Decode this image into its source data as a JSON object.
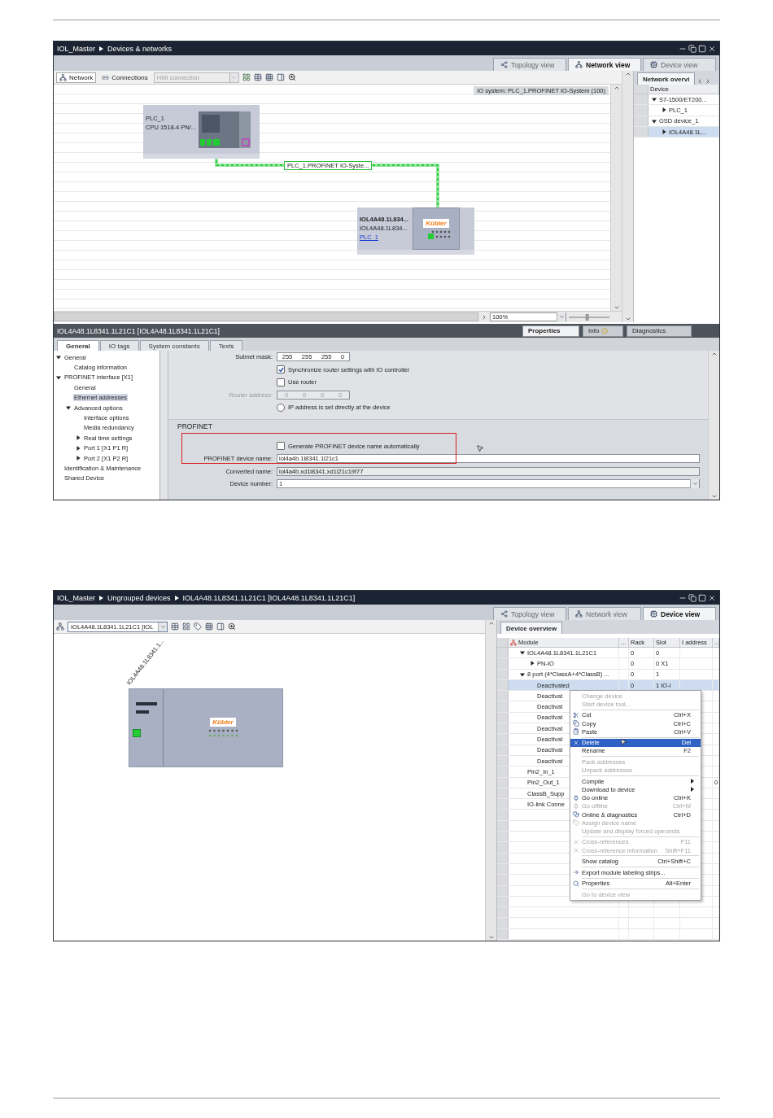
{
  "network_view": {
    "breadcrumb": [
      "IOL_Master",
      "Devices & networks"
    ],
    "view_tabs": [
      {
        "label": "Topology view",
        "selected": false
      },
      {
        "label": "Network view",
        "selected": true
      },
      {
        "label": "Device view",
        "selected": false
      }
    ],
    "toolbar": {
      "network": "Network",
      "connections": "Connections",
      "connection_type": {
        "value": "HMI connection",
        "disabled": true
      }
    },
    "io_system": "IO system: PLC_1.PROFINET IO-System (100)",
    "plc": {
      "name": "PLC_1",
      "type": "CPU 1518-4 PN/..."
    },
    "subnet": "PLC_1.PROFINET IO-Syste...",
    "device": {
      "name": "IOL4A48.1L834...",
      "type": "IOL4A48.1L834...",
      "link": "PLC_1",
      "logo": "Kübler"
    },
    "zoom": "100%",
    "zoom_slider": {
      "level": 0.45
    },
    "overview": {
      "tab": "Network overvi",
      "column": "Device",
      "tree": [
        {
          "label": "S7-1500/ET200...",
          "expanded": true,
          "selected": false,
          "children": [
            {
              "label": "PLC_1",
              "expanded": false,
              "selected": false
            }
          ]
        },
        {
          "label": "GSD device_1",
          "expanded": true,
          "selected": false,
          "children": [
            {
              "label": "IOL4A48.1L...",
              "expanded": false,
              "selected": true
            }
          ]
        }
      ]
    },
    "inspector": {
      "title": "IOL4A48.1L8341.1L21C1 [IOL4A48.1L8341.1L21C1]",
      "panel_tabs": [
        {
          "label": "Properties",
          "selected": true
        },
        {
          "label": "Info",
          "selected": false
        },
        {
          "label": "Diagnostics",
          "selected": false
        }
      ],
      "tabs": [
        {
          "label": "General",
          "selected": true
        },
        {
          "label": "IO tags",
          "selected": false
        },
        {
          "label": "System constants",
          "selected": false
        },
        {
          "label": "Texts",
          "selected": false
        }
      ],
      "nav": [
        {
          "label": "General",
          "expanded": true,
          "selected": false,
          "children": [
            {
              "label": "Catalog information",
              "selected": false
            }
          ]
        },
        {
          "label": "PROFINET interface [X1]",
          "expanded": true,
          "selected": false,
          "children": [
            {
              "label": "General",
              "selected": false
            },
            {
              "label": "Ethernet addresses",
              "selected": true
            },
            {
              "label": "Advanced options",
              "expanded": true,
              "selected": false,
              "children": [
                {
                  "label": "Interface options",
                  "selected": false
                },
                {
                  "label": "Media redundancy",
                  "selected": false
                },
                {
                  "label": "Real time settings",
                  "expanded": false,
                  "selected": false
                },
                {
                  "label": "Port 1 [X1 P1 R]",
                  "expanded": false,
                  "selected": false
                },
                {
                  "label": "Port 2 [X1 P2 R]",
                  "expanded": false,
                  "selected": false
                }
              ]
            }
          ]
        },
        {
          "label": "Identification & Maintenance",
          "selected": false
        },
        {
          "label": "Shared Device",
          "selected": false
        }
      ],
      "subnet_mask": {
        "label": "Subnet mask:",
        "octets": [
          "255",
          "255",
          "255",
          "0"
        ]
      },
      "sync_router": {
        "label": "Synchronize router settings with IO controller",
        "checked": true
      },
      "use_router": {
        "label": "Use router",
        "checked": false
      },
      "router_address": {
        "label": "Router address:",
        "octets": [
          "0",
          "0",
          "0",
          "0"
        ],
        "disabled": true
      },
      "ip_direct": {
        "label": "IP address is set directly at the device",
        "selected": false
      },
      "profinet": {
        "title": "PROFINET",
        "auto_name": {
          "label": "Generate PROFINET device name automatically",
          "checked": false
        },
        "device_name": {
          "label": "PROFINET device name:",
          "value": "iol4a4b.1l8341.1l21c1"
        },
        "converted_name": {
          "label": "Converted name:",
          "value": "iol4a4b.xd1l8341.xd1l21c19f77"
        },
        "device_number": {
          "label": "Device number:",
          "value": "1"
        }
      }
    }
  },
  "device_view": {
    "breadcrumb": [
      "IOL_Master",
      "Ungrouped devices",
      "IOL4A48.1L8341.1L21C1 [IOL4A48.1L8341.1L21C1]"
    ],
    "view_tabs": [
      {
        "label": "Topology view",
        "selected": false
      },
      {
        "label": "Network view",
        "selected": false
      },
      {
        "label": "Device view",
        "selected": true
      }
    ],
    "device_select": "IOL4A48.1L8341.1L21C1 [IOL",
    "canvas_label": "IOL4A48.1L8341.1...",
    "logo": "Kübler",
    "overview": {
      "tab": "Device overview",
      "columns": [
        "Module",
        "...",
        "Rack",
        "Slot",
        "I address",
        "..."
      ],
      "rows": [
        {
          "module": "IOL4A48.1L8341.1L21C1",
          "rack": "0",
          "slot": "0",
          "expanded": true,
          "selected": false,
          "children": [
            {
              "module": "PN-IO",
              "rack": "0",
              "slot": "0 X1",
              "expanded": false,
              "selected": false
            }
          ]
        },
        {
          "module": "8 port (4*ClassA+4*ClassB) ...",
          "rack": "0",
          "slot": "1",
          "expanded": true,
          "selected": false,
          "children": [
            {
              "module": "Deactivated",
              "rack": "0",
              "slot": "1 IO-l",
              "selected": true
            },
            {
              "module": "Deactivat",
              "selected": false
            },
            {
              "module": "Deactivat",
              "selected": false
            },
            {
              "module": "Deactivat",
              "selected": false
            },
            {
              "module": "Deactivat",
              "selected": false
            },
            {
              "module": "Deactivat",
              "selected": false
            },
            {
              "module": "Deactivat",
              "selected": false
            },
            {
              "module": "Deactivat",
              "selected": false
            }
          ]
        },
        {
          "module": "Pin2_In_1",
          "selected": false
        },
        {
          "module": "Pin2_Out_1",
          "column_6": "0",
          "selected": false
        },
        {
          "module": "ClassB_Supp",
          "selected": false
        },
        {
          "module": "IO-link Conne",
          "selected": false
        }
      ]
    },
    "context_menu": [
      {
        "kind": "item",
        "label": "Change device",
        "disabled": true,
        "selected": false
      },
      {
        "kind": "item",
        "label": "Start device tool...",
        "disabled": true,
        "selected": false
      },
      {
        "kind": "separator"
      },
      {
        "kind": "item",
        "label": "Cut",
        "shortcut": "Ctrl+X",
        "disabled": false,
        "selected": false
      },
      {
        "kind": "item",
        "label": "Copy",
        "shortcut": "Ctrl+C",
        "disabled": false,
        "selected": false
      },
      {
        "kind": "item",
        "label": "Paste",
        "shortcut": "Ctrl+V",
        "disabled": false,
        "selected": false
      },
      {
        "kind": "separator"
      },
      {
        "kind": "item",
        "label": "Delete",
        "shortcut": "Del",
        "disabled": false,
        "selected": true
      },
      {
        "kind": "item",
        "label": "Rename",
        "shortcut": "F2",
        "disabled": false,
        "selected": false
      },
      {
        "kind": "separator"
      },
      {
        "kind": "item",
        "label": "Pack addresses",
        "disabled": true,
        "selected": false
      },
      {
        "kind": "item",
        "label": "Unpack addresses",
        "disabled": true,
        "selected": false
      },
      {
        "kind": "separator"
      },
      {
        "kind": "item",
        "label": "Compile",
        "submenu": true,
        "disabled": false,
        "selected": false
      },
      {
        "kind": "item",
        "label": "Download to device",
        "submenu": true,
        "disabled": false,
        "selected": false
      },
      {
        "kind": "item",
        "label": "Go online",
        "shortcut": "Ctrl+K",
        "disabled": false,
        "selected": false
      },
      {
        "kind": "item",
        "label": "Go offline",
        "shortcut": "Ctrl+M",
        "disabled": true,
        "selected": false
      },
      {
        "kind": "item",
        "label": "Online & diagnostics",
        "shortcut": "Ctrl+D",
        "disabled": false,
        "selected": false
      },
      {
        "kind": "item",
        "label": "Assign device name",
        "disabled": true,
        "selected": false
      },
      {
        "kind": "item",
        "label": "Update and display forced operands",
        "disabled": true,
        "selected": false
      },
      {
        "kind": "separator"
      },
      {
        "kind": "item",
        "label": "Cross-references",
        "shortcut": "F11",
        "disabled": true,
        "selected": false
      },
      {
        "kind": "item",
        "label": "Cross-reference information",
        "shortcut": "Shift+F11",
        "disabled": true,
        "selected": false
      },
      {
        "kind": "separator"
      },
      {
        "kind": "item",
        "label": "Show catalog",
        "shortcut": "Ctrl+Shift+C",
        "disabled": false,
        "selected": false
      },
      {
        "kind": "separator"
      },
      {
        "kind": "item",
        "label": "Export module labeling strips...",
        "disabled": false,
        "selected": false
      },
      {
        "kind": "separator"
      },
      {
        "kind": "item",
        "label": "Properties",
        "shortcut": "Alt+Enter",
        "disabled": false,
        "selected": false
      },
      {
        "kind": "separator"
      },
      {
        "kind": "item",
        "label": "Go to device view",
        "disabled": true,
        "selected": false
      }
    ]
  }
}
